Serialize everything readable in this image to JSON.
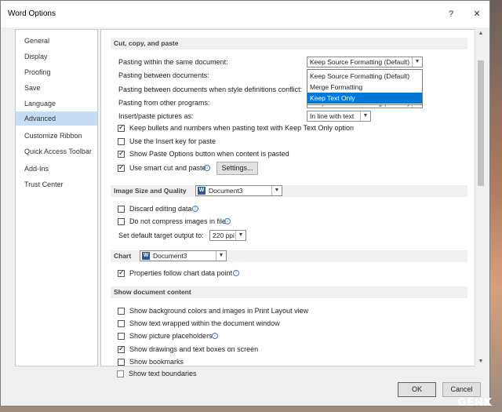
{
  "window": {
    "title": "Word Options"
  },
  "titlebar": {
    "help": "?",
    "close": "✕"
  },
  "nav": {
    "items": [
      {
        "label": "General"
      },
      {
        "label": "Display"
      },
      {
        "label": "Proofing"
      },
      {
        "label": "Save"
      },
      {
        "label": "Language"
      },
      {
        "label": "Advanced",
        "active": true
      },
      {
        "label": "Customize Ribbon"
      },
      {
        "label": "Quick Access Toolbar"
      },
      {
        "label": "Add-Ins"
      },
      {
        "label": "Trust Center"
      }
    ]
  },
  "cut_copy_paste": {
    "heading": "Cut, copy, and paste",
    "pasting_within_label": "Pasting within the same document:",
    "pasting_within_value": "Keep Source Formatting (Default)",
    "pasting_between_label": "Pasting between documents:",
    "pasting_between_style_label": "Pasting between documents when style definitions conflict:",
    "pasting_from_other_label": "Pasting from other programs:",
    "pasting_from_other_value": "Keep Source Formatting (Default)",
    "insert_pictures_label": "Insert/paste pictures as:",
    "insert_pictures_value": "In line with text",
    "dropdown_options": [
      "Keep Source Formatting (Default)",
      "Merge Formatting",
      "Keep Text Only"
    ],
    "dropdown_selected": "Keep Text Only",
    "checkboxes": [
      {
        "label": "Keep bullets and numbers when pasting text with Keep Text Only option",
        "checked": true
      },
      {
        "label": "Use the Insert key for paste",
        "checked": false
      },
      {
        "label": "Show Paste Options button when content is pasted",
        "checked": true
      },
      {
        "label": "Use smart cut and paste",
        "checked": true
      }
    ],
    "settings_button": "Settings..."
  },
  "image_size": {
    "heading": "Image Size and Quality",
    "document": "Document3",
    "discard_label": "Discard editing data",
    "discard_checked": false,
    "no_compress_label": "Do not compress images in file",
    "no_compress_checked": false,
    "ppi_label": "Set default target output to:",
    "ppi_value": "220 ppi"
  },
  "chart": {
    "heading": "Chart",
    "document": "Document3",
    "properties_label": "Properties follow chart data point",
    "properties_checked": true
  },
  "show_content": {
    "heading": "Show document content",
    "checkboxes": [
      {
        "label": "Show background colors and images in Print Layout view",
        "checked": false
      },
      {
        "label": "Show text wrapped within the document window",
        "checked": false
      },
      {
        "label": "Show picture placeholders",
        "checked": false
      },
      {
        "label": "Show drawings and text boxes on screen",
        "checked": true
      },
      {
        "label": "Show bookmarks",
        "checked": false
      },
      {
        "label": "Show text boundaries",
        "checked": false
      }
    ]
  },
  "footer": {
    "ok": "OK",
    "cancel": "Cancel"
  },
  "watermark": "GENK"
}
